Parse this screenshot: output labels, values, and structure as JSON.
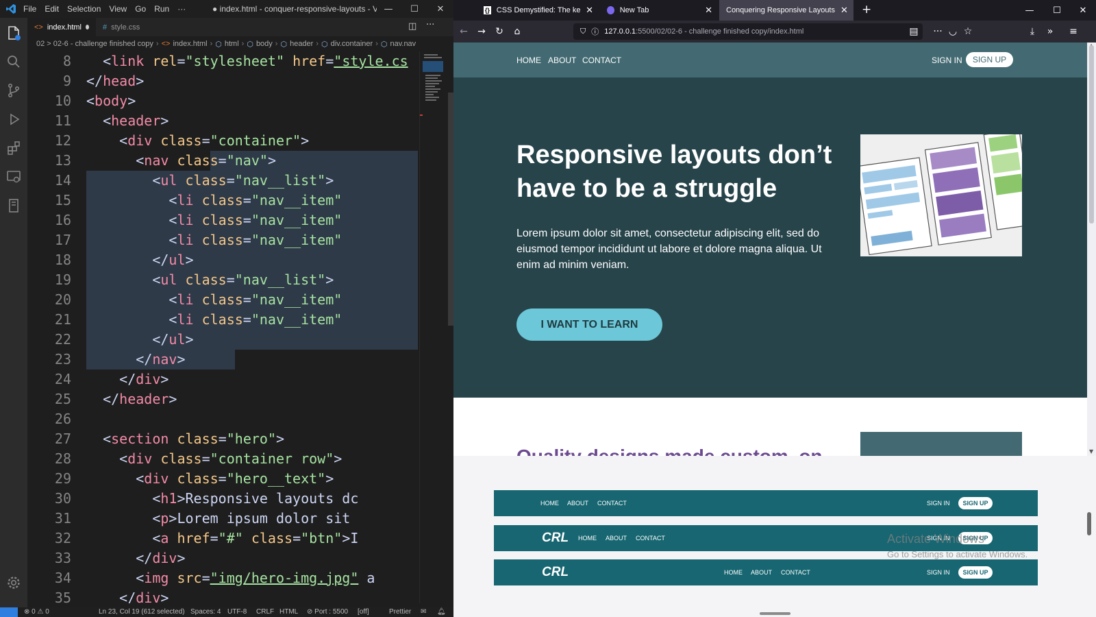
{
  "vscode": {
    "menu": [
      "File",
      "Edit",
      "Selection",
      "View",
      "Go",
      "Run",
      "···"
    ],
    "window_title": "● index.html - conquer-responsive-layouts - Visual ...",
    "tabs": [
      {
        "label": "index.html",
        "modified": true
      },
      {
        "label": "style.css",
        "modified": false
      }
    ],
    "breadcrumb": [
      "02 > 02-6 - challenge finished copy",
      "index.html",
      "html",
      "body",
      "header",
      "div.container",
      "nav.nav"
    ],
    "code_lines": [
      {
        "n": "8",
        "text": "<link rel=\"stylesheet\" href=\"style.cs"
      },
      {
        "n": "9",
        "text": "</head>"
      },
      {
        "n": "10",
        "text": "<body>"
      },
      {
        "n": "11",
        "text": "<header>"
      },
      {
        "n": "12",
        "text": "<div class=\"container\">"
      },
      {
        "n": "13",
        "text": "<nav class=\"nav\">"
      },
      {
        "n": "14",
        "text": "<ul class=\"nav__list\">"
      },
      {
        "n": "15",
        "text": "<li class=\"nav__item\""
      },
      {
        "n": "16",
        "text": "<li class=\"nav__item\""
      },
      {
        "n": "17",
        "text": "<li class=\"nav__item\""
      },
      {
        "n": "18",
        "text": "</ul>"
      },
      {
        "n": "19",
        "text": "<ul class=\"nav__list\">"
      },
      {
        "n": "20",
        "text": "<li class=\"nav__item\""
      },
      {
        "n": "21",
        "text": "<li class=\"nav__item\""
      },
      {
        "n": "22",
        "text": "</ul>"
      },
      {
        "n": "23",
        "text": "</nav>"
      },
      {
        "n": "24",
        "text": "</div>"
      },
      {
        "n": "25",
        "text": "</header>"
      },
      {
        "n": "26",
        "text": ""
      },
      {
        "n": "27",
        "text": "<section class=\"hero\">"
      },
      {
        "n": "28",
        "text": "<div class=\"container row\">"
      },
      {
        "n": "29",
        "text": "<div class=\"hero__text\">"
      },
      {
        "n": "30",
        "text": "<h1>Responsive layouts dc"
      },
      {
        "n": "31",
        "text": "<p>Lorem ipsum dolor sit"
      },
      {
        "n": "32",
        "text": "<a href=\"#\" class=\"btn\">I"
      },
      {
        "n": "33",
        "text": "</div>"
      },
      {
        "n": "34",
        "text": "<img src=\"img/hero-img.jpg\" a"
      },
      {
        "n": "35",
        "text": "</div>"
      }
    ],
    "status": {
      "problems": "⊗ 0 ⚠ 0",
      "position": "Ln 23, Col 19 (612 selected)",
      "spaces": "Spaces: 4",
      "encoding": "UTF-8",
      "eol": "CRLF",
      "language": "HTML",
      "port": "⊘ Port : 5500",
      "live": "[off]",
      "formatter": "Prettier"
    }
  },
  "browser": {
    "tabs": [
      {
        "label": "CSS Demystified: The keys to m",
        "active": false
      },
      {
        "label": "New Tab",
        "active": false
      },
      {
        "label": "Conquering Responsive Layouts",
        "active": true
      }
    ],
    "url_host": "127.0.0.1",
    "url_path": ":5500/02/02-6 - challenge finished copy/index.html",
    "site": {
      "nav_left": [
        "HOME",
        "ABOUT",
        "CONTACT"
      ],
      "sign_in": "SIGN IN",
      "sign_up": "SIGN UP",
      "hero_title": "Responsive layouts don’t have to be a struggle",
      "hero_text": "Lorem ipsum dolor sit amet, consectetur adipiscing elit, sed do eiusmod tempor incididunt ut labore et dolore magna aliqua. Ut enim ad minim veniam.",
      "hero_button": "I WANT TO LEARN",
      "section2_title": "Quality designs made custom, on"
    },
    "demo_bars": [
      {
        "logo": "",
        "links": [
          "HOME",
          "ABOUT",
          "CONTACT"
        ],
        "sign_in": "SIGN IN",
        "sign_up": "SIGN UP"
      },
      {
        "logo": "CRL",
        "links": [
          "HOME",
          "ABOUT",
          "CONTACT"
        ],
        "sign_in": "SIGN IN",
        "sign_up": "SIGN UP"
      },
      {
        "logo": "CRL",
        "links": [
          "HOME",
          "ABOUT",
          "CONTACT"
        ],
        "sign_in": "SIGN IN",
        "sign_up": "SIGN UP"
      }
    ],
    "watermark": [
      "Activate Windows",
      "Go to Settings to activate Windows."
    ]
  },
  "colors": {
    "site_header": "#436a72",
    "hero_bg": "#27444b",
    "hero_button": "#6cc8d8",
    "demo_bar": "#176671"
  }
}
